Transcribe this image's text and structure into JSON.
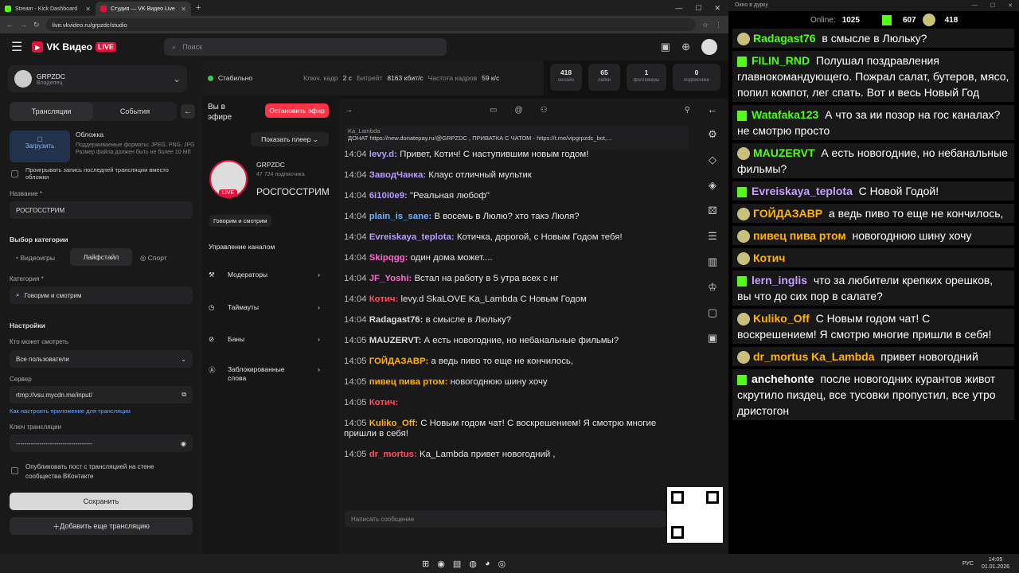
{
  "tabs": [
    {
      "label": "Stream - Kick Dashboard",
      "color": "#53fc18"
    },
    {
      "label": "Студия — VK Видео Live",
      "color": "#e0113a"
    }
  ],
  "url": "live.vkvideo.ru/grpzdc/studio",
  "header": {
    "brand": "VK Видео",
    "live_badge": "LIVE",
    "search_placeholder": "Поиск"
  },
  "channel": {
    "name": "GRPZDC",
    "role": "Владелец"
  },
  "left": {
    "tabs": [
      "Трансляции",
      "События"
    ],
    "cover_title": "Обложка",
    "cover_upload": "Загрузить",
    "cover_hint": "Поддерживаемые форматы: JPEG, PNG, JPG Размер файла должен быть не более 10 Мб",
    "replay_checkbox": "Проигрывать запись последней трансляции вместо обложки",
    "name_label": "Название *",
    "name_value": "РОСГОССТРИМ",
    "category_section": "Выбор категории",
    "category_tabs": [
      "Видеоигры",
      "Лайфстайл",
      "Спорт"
    ],
    "category_label": "Категория *",
    "category_value": "Говорим и смотрим",
    "settings": "Настройки",
    "who_label": "Кто может смотреть",
    "who_value": "Все пользователи",
    "server_label": "Сервер",
    "server_value": "rtmp://vsu.mycdn.me/input/",
    "setup_link": "Как настроить приложение для трансляции",
    "key_label": "Ключ трансляции",
    "key_value": "------------------------------------",
    "publish_checkbox": "Опубликовать пост с трансляцией на стене сообщества ВКонтакте",
    "save": "Сохранить",
    "add": "Добавить еще трансляцию"
  },
  "status": {
    "state": "Стабильно",
    "keyframe_label": "Ключ. кадр",
    "keyframe": "2 с",
    "bitrate_label": "Битрейт",
    "bitrate": "8163 кбит/с",
    "fps_label": "Частота кадров",
    "fps": "59 к/с"
  },
  "stats": [
    {
      "value": "418",
      "label": "онлайн"
    },
    {
      "value": "65",
      "label": "лайки"
    },
    {
      "value": "1",
      "label": "фолловеры"
    },
    {
      "value": "0",
      "label": "подписчики"
    }
  ],
  "mid": {
    "on_air": "Вы в эфире",
    "stop": "Остановить эфир",
    "show_player": "Показать плеер",
    "subs": "47 724 подписчика",
    "title": "РОСГОССТРИМ",
    "live": "LIVE",
    "tag": "Говорим и смотрим",
    "manage": "Управление каналом",
    "menu": [
      "Модераторы",
      "Таймауты",
      "Баны",
      "Заблокированные слова"
    ]
  },
  "chat": {
    "pinned_user": "Ka_Lambda",
    "pinned_text": "ДОНАТ https://new.donatepay.ru/@GRPZDC , ПРИВАТКА С ЧАТОМ - https://t.me/vipgrpzdc_bot,...",
    "input_placeholder": "Написать сообщение",
    "messages": [
      {
        "t": "14:04",
        "u": "levy.d:",
        "c": "#b59cff",
        "x": "Привет, Котич! С наступившим новым годом!"
      },
      {
        "t": "14:04",
        "u": "ЗаводЧанка:",
        "c": "#b59cff",
        "x": "Клаус отличный мультик"
      },
      {
        "t": "14:04",
        "u": "6i10i0e9:",
        "c": "#b59cff",
        "x": "\"Реальная любоф\""
      },
      {
        "t": "14:04",
        "u": "plain_is_sane:",
        "c": "#6fb0ff",
        "x": "В восемь в Люлю? хто такэ Люля?"
      },
      {
        "t": "14:04",
        "u": "Evreiskaya_teplota:",
        "c": "#b59cff",
        "x": "Котичка, дорогой, с Новым Годом тебя!"
      },
      {
        "t": "14:04",
        "u": "Skipqgg:",
        "c": "#ff66cc",
        "x": "один дома может...."
      },
      {
        "t": "14:04",
        "u": "JF_Yoshi:",
        "c": "#ff66cc",
        "x": "Встал на работу в 5 утра всех с нг"
      },
      {
        "t": "14:04",
        "u": "Котич:",
        "c": "#ff5060",
        "x": "levy.d SkaLOVE Ka_Lambda С Новым Годом"
      },
      {
        "t": "14:04",
        "u": "Radagast76:",
        "c": "#ddd",
        "x": "в смысле в Люльку?"
      },
      {
        "t": "14:05",
        "u": "MAUZERVT:",
        "c": "#ddd",
        "x": "А есть новогодние, но небанальные фильмы?"
      },
      {
        "t": "14:05",
        "u": "ГОЙДАЗАВР:",
        "c": "#ffb400",
        "x": "а ведь пиво то еще не кончилось,"
      },
      {
        "t": "14:05",
        "u": "пивец пива ртом:",
        "c": "#ffb400",
        "x": "новогоднюю шину хочу"
      },
      {
        "t": "14:05",
        "u": "Котич:",
        "c": "#ff5060",
        "x": ""
      },
      {
        "t": "14:05",
        "u": "Kuliko_Off:",
        "c": "#ffb400",
        "x": "С Новым годом чат! С воскрешением! Я смотрю многие пришли в себя!"
      },
      {
        "t": "14:05",
        "u": "dr_mortus:",
        "c": "#ff5060",
        "x": "Ka_Lambda привет новогодний ,"
      }
    ]
  },
  "popup": {
    "title": "Окно в дурку",
    "online_label": "Online:",
    "online": "1025",
    "kick": "607",
    "vk": "418",
    "messages": [
      {
        "u": "Radagast76",
        "c": "#53fc18",
        "x": "в смысле в Люльку?",
        "b": "e"
      },
      {
        "u": "FILIN_RND",
        "c": "#53fc18",
        "x": "Полушал поздравления главнокомандующего. Пожрал салат, бутеров, мясо, попил компот, лег спать. Вот и весь Новый Год",
        "b": "k"
      },
      {
        "u": "Watafaka123",
        "c": "#53fc18",
        "x": "А что за ии позор на гос каналах? не смотрю просто",
        "b": "k"
      },
      {
        "u": "MAUZERVT",
        "c": "#53fc18",
        "x": "А есть новогодние, но небанальные фильмы?",
        "b": "e"
      },
      {
        "u": "Evreiskaya_teplota",
        "c": "#c8a0ff",
        "x": "С Новой Годой!",
        "b": "k"
      },
      {
        "u": "ГОЙДАЗАВР",
        "c": "#ffb400",
        "x": "а ведь пиво то еще не кончилось,",
        "b": "e"
      },
      {
        "u": "пивец пива ртом",
        "c": "#ffb400",
        "x": "новогоднюю шину хочу",
        "b": "e"
      },
      {
        "u": "Котич",
        "c": "#ffb400",
        "x": "",
        "b": "e"
      },
      {
        "u": "lern_inglis",
        "c": "#c8a0ff",
        "x": "что за любители крепких орешков, вы что до сих пор в салате?",
        "b": "k"
      },
      {
        "u": "Kuliko_Off",
        "c": "#ffb400",
        "x": "С Новым годом чат! С воскрешением! Я смотрю многие пришли в себя!",
        "b": "e"
      },
      {
        "u": "dr_mortus  Ka_Lambda",
        "c": "#ffb400",
        "x": "привет новогодний",
        "b": "e"
      },
      {
        "u": "anchehonte",
        "c": "#fff",
        "x": "после новогодних курантов живот скрутило пиздец, все тусовки пропустил, все утро дристогон",
        "b": "k"
      }
    ]
  },
  "taskbar": {
    "lang": "РУС",
    "time": "14:05",
    "date": "01.01.2026"
  }
}
